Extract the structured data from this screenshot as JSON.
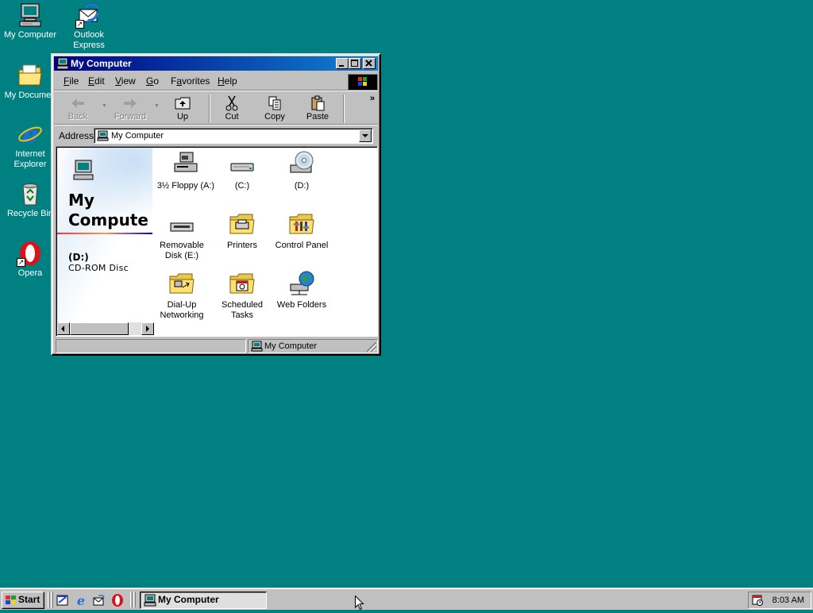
{
  "desktop": {
    "background_color": "#008080",
    "icons": [
      {
        "label": "My Computer",
        "icon": "my-computer-icon"
      },
      {
        "label": "Outlook\nExpress",
        "icon": "outlook-express-icon"
      },
      {
        "label": "My Documen",
        "icon": "my-documents-icon"
      },
      {
        "label": "Internet\nExplorer",
        "icon": "internet-explorer-icon"
      },
      {
        "label": "Recycle Bin",
        "icon": "recycle-bin-icon"
      },
      {
        "label": "Opera",
        "icon": "opera-icon"
      }
    ]
  },
  "window": {
    "title": "My Computer",
    "title_gradient": [
      "#000080",
      "#1084d0"
    ],
    "controls": {
      "minimize": "_",
      "maximize": "□",
      "close": "×"
    },
    "menu": [
      "File",
      "Edit",
      "View",
      "Go",
      "Favorites",
      "Help"
    ],
    "menu_underline": [
      "F",
      "E",
      "V",
      "G",
      "a",
      "H"
    ],
    "toolbar": {
      "back": "Back",
      "forward": "Forward",
      "up": "Up",
      "cut": "Cut",
      "copy": "Copy",
      "paste": "Paste",
      "more": "»"
    },
    "address": {
      "label": "Address",
      "value": "My Computer"
    },
    "info_pane": {
      "title": "My\nCompute",
      "selected_name": "(D:)",
      "selected_type": "CD-ROM Disc"
    },
    "items": [
      {
        "label": "3½ Floppy (A:)",
        "icon": "floppy-drive-icon"
      },
      {
        "label": "(C:)",
        "icon": "hard-drive-icon"
      },
      {
        "label": "(D:)",
        "icon": "cd-drive-icon"
      },
      {
        "label": "Removable\nDisk (E:)",
        "icon": "removable-disk-icon"
      },
      {
        "label": "Printers",
        "icon": "printers-folder-icon"
      },
      {
        "label": "Control Panel",
        "icon": "control-panel-icon"
      },
      {
        "label": "Dial-Up\nNetworking",
        "icon": "dial-up-networking-icon"
      },
      {
        "label": "Scheduled\nTasks",
        "icon": "scheduled-tasks-icon"
      },
      {
        "label": "Web Folders",
        "icon": "web-folders-icon"
      }
    ],
    "status": "My Computer"
  },
  "taskbar": {
    "start_label": "Start",
    "task_label": "My Computer",
    "clock": "8:03 AM",
    "quick_launch": [
      "show-desktop-icon",
      "internet-explorer-icon",
      "outlook-express-icon",
      "opera-icon"
    ]
  }
}
